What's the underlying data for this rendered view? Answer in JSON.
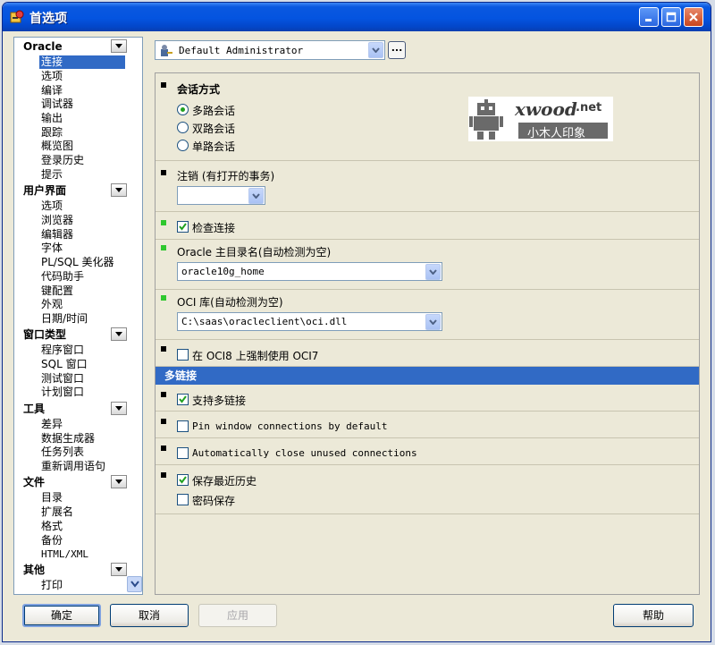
{
  "window": {
    "title": "首选项"
  },
  "title_buttons": {
    "minimize": "minimize-icon",
    "maximize": "maximize-icon",
    "close": "close-icon"
  },
  "tree": {
    "groups": [
      {
        "label": "Oracle",
        "items": [
          "连接",
          "选项",
          "编译",
          "调试器",
          "输出",
          "跟踪",
          "概览图",
          "登录历史",
          "提示"
        ]
      },
      {
        "label": "用户界面",
        "items": [
          "选项",
          "浏览器",
          "编辑器",
          "字体",
          "PL/SQL 美化器",
          "代码助手",
          "键配置",
          "外观",
          "日期/时间"
        ]
      },
      {
        "label": "窗口类型",
        "items": [
          "程序窗口",
          "SQL 窗口",
          "测试窗口",
          "计划窗口"
        ]
      },
      {
        "label": "工具",
        "items": [
          "差异",
          "数据生成器",
          "任务列表",
          "重新调用语句"
        ]
      },
      {
        "label": "文件",
        "items": [
          "目录",
          "扩展名",
          "格式",
          "备份",
          "HTML/XML"
        ]
      },
      {
        "label": "其他",
        "items": [
          "打印"
        ]
      }
    ],
    "selected": "连接"
  },
  "profile": {
    "value": "Default Administrator",
    "more_label": "..."
  },
  "logo": {
    "brand": "xwood",
    "suffix": ".net",
    "tagline": "小木人印象"
  },
  "session": {
    "title": "会话方式",
    "options": [
      "多路会话",
      "双路会话",
      "单路会话"
    ],
    "selected": "多路会话"
  },
  "logoff": {
    "title": "注销 (有打开的事务)",
    "value": ""
  },
  "check_connection": {
    "label": "检查连接",
    "checked": true
  },
  "oracle_home": {
    "title": "Oracle 主目录名(自动检测为空)",
    "value": "oracle10g_home"
  },
  "oci_lib": {
    "title": "OCI 库(自动检测为空)",
    "value": "C:\\saas\\oracleclient\\oci.dll"
  },
  "force_oci7": {
    "label": "在 OCI8 上强制使用 OCI7",
    "checked": false
  },
  "multi": {
    "band": "多链接",
    "support": {
      "label": "支持多链接",
      "checked": true
    },
    "pin": {
      "label": "Pin window connections by default",
      "checked": false
    },
    "auto_close": {
      "label": "Automatically close unused connections",
      "checked": false
    },
    "save_history": {
      "label": "保存最近历史",
      "checked": true
    },
    "save_password": {
      "label": "密码保存",
      "checked": false
    }
  },
  "buttons": {
    "ok": "确定",
    "cancel": "取消",
    "apply": "应用",
    "help": "帮助"
  },
  "colors": {
    "title_bar": "#0454e0",
    "selection": "#316ac5",
    "marker_green": "#2ec82e",
    "window_bg": "#ece9d8"
  }
}
